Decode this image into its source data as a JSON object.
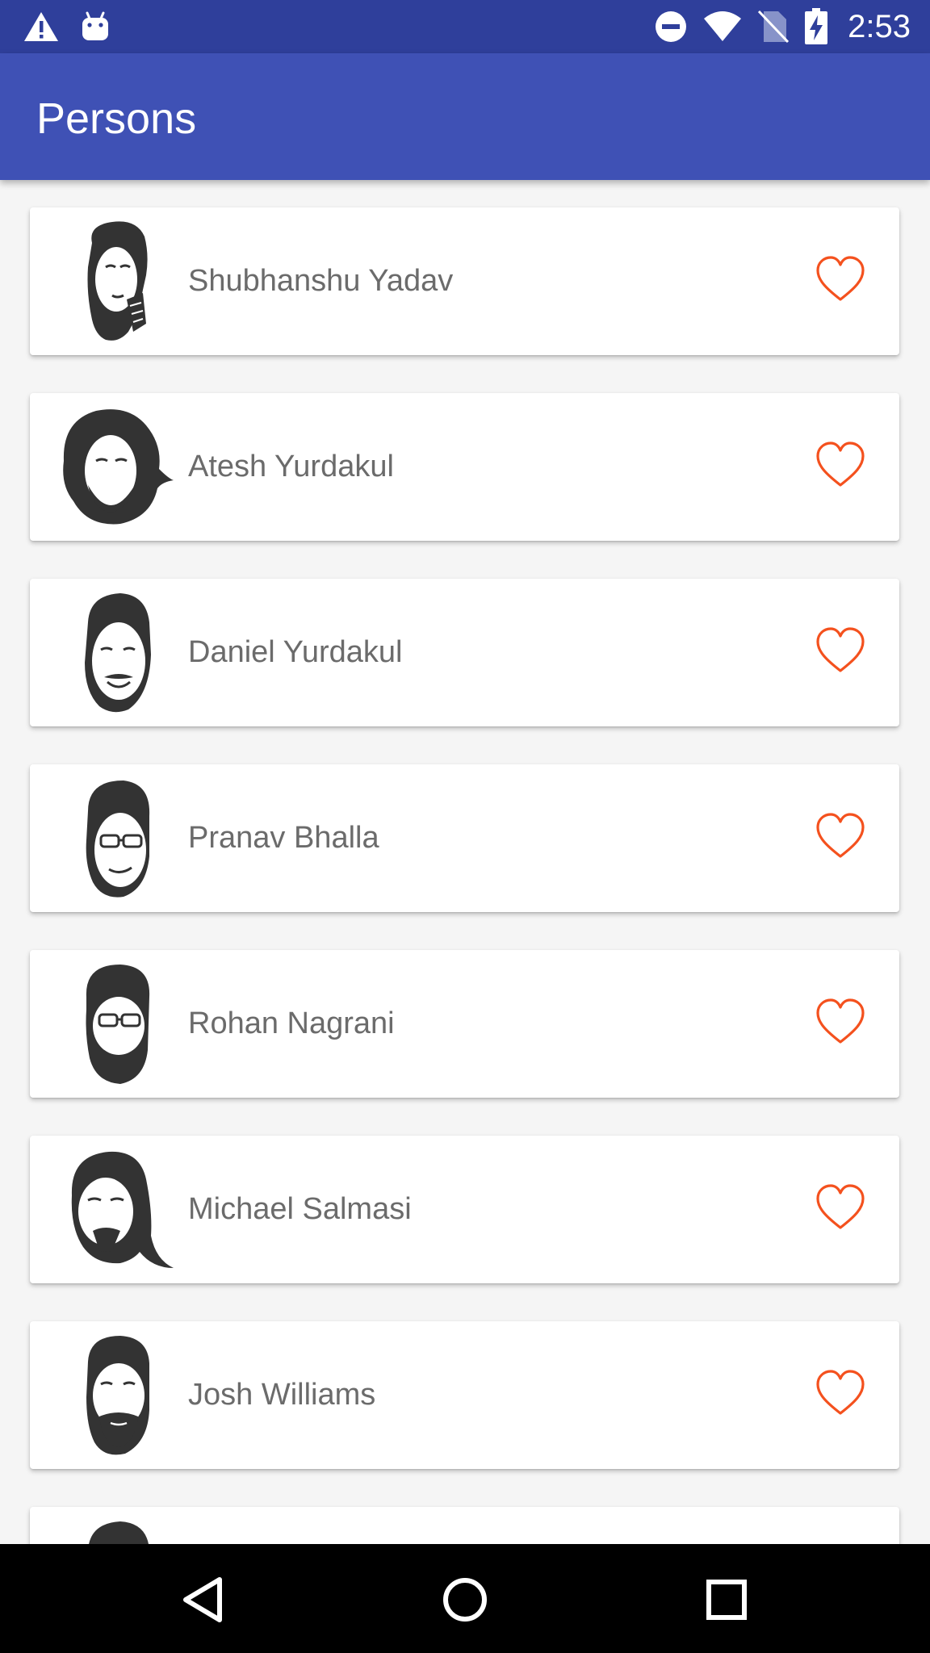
{
  "status_bar": {
    "time": "2:53",
    "left_icons": [
      "warning-icon",
      "android-icon"
    ],
    "right_icons": [
      "do-not-disturb-icon",
      "wifi-icon",
      "no-sim-icon",
      "battery-charging-icon"
    ]
  },
  "app_bar": {
    "title": "Persons",
    "color": "#3f51b5",
    "status_color": "#2f3f9b"
  },
  "persons": [
    {
      "name": "Shubhanshu Yadav",
      "avatar_icon": "person-sketch-hand-on-face-icon",
      "favorite": false
    },
    {
      "name": "Atesh Yurdakul",
      "avatar_icon": "person-sketch-curly-hair-beard-icon",
      "favorite": false
    },
    {
      "name": "Daniel Yurdakul",
      "avatar_icon": "person-sketch-mustache-smile-icon",
      "favorite": false
    },
    {
      "name": "Pranav Bhalla",
      "avatar_icon": "person-sketch-glasses-icon",
      "favorite": false
    },
    {
      "name": "Rohan Nagrani",
      "avatar_icon": "person-sketch-glasses-beard-icon",
      "favorite": false
    },
    {
      "name": "Michael Salmasi",
      "avatar_icon": "person-sketch-long-hair-goatee-icon",
      "favorite": false
    },
    {
      "name": "Josh Williams",
      "avatar_icon": "person-sketch-short-hair-beard-icon",
      "favorite": false
    },
    {
      "name": "",
      "avatar_icon": "person-sketch-partial-icon",
      "favorite": false
    }
  ],
  "favorite_icon": "heart-outline-icon",
  "favorite_color": "#f4511e",
  "nav_bar": {
    "buttons": [
      "back-icon",
      "home-icon",
      "recents-icon"
    ]
  }
}
